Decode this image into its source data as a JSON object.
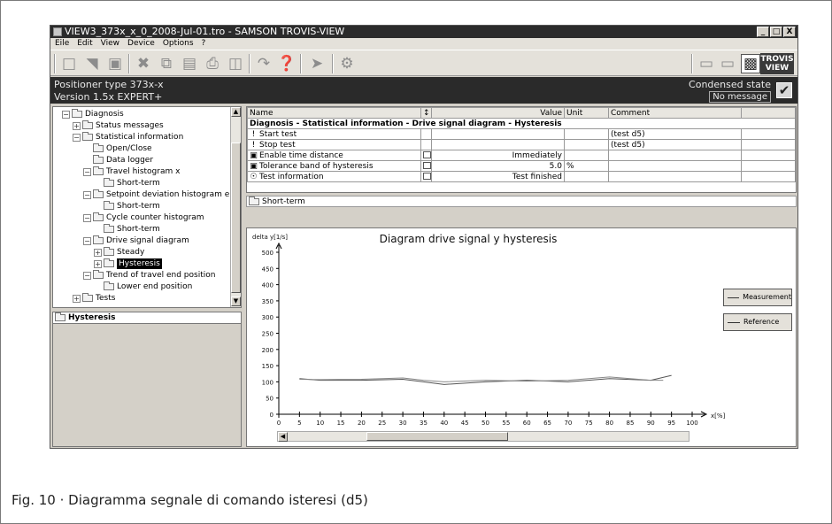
{
  "window": {
    "title": "VIEW3_373x_x_0_2008-Jul-01.tro - SAMSON TROVIS-VIEW",
    "buttons": [
      "_",
      "□",
      "X"
    ]
  },
  "menu": [
    "Eile",
    "Edit",
    "View",
    "Device",
    "Options",
    "?"
  ],
  "toolbar": {
    "buttons": [
      "new-icon",
      "open-icon",
      "save-icon",
      "cut-icon",
      "copy-icon",
      "paste-icon",
      "print-icon",
      "print-preview-icon",
      "transfer-icon",
      "help-icon",
      "tools-icon",
      "settings-icon"
    ],
    "logo_line1": "TROVIS",
    "logo_line2": "VIEW"
  },
  "info": {
    "line1": "Positioner type 373x-x",
    "line2": "Version 1.5x EXPERT+",
    "state_label": "Condensed state",
    "message": "No message"
  },
  "tree": {
    "items": [
      {
        "label": "Diagnosis",
        "expander": "−",
        "sel": false
      },
      {
        "label": "Status messages",
        "expander": "+",
        "sel": false
      },
      {
        "label": "Statistical information",
        "expander": "−",
        "sel": false
      },
      {
        "label": "Open/Close",
        "expander": "",
        "sel": false
      },
      {
        "label": "Data logger",
        "expander": "",
        "sel": false
      },
      {
        "label": "Travel histogram x",
        "expander": "−",
        "sel": false
      },
      {
        "label": "Short-term",
        "expander": "",
        "sel": false
      },
      {
        "label": "Setpoint deviation histogram e",
        "expander": "−",
        "sel": false
      },
      {
        "label": "Short-term",
        "expander": "",
        "sel": false
      },
      {
        "label": "Cycle counter histogram",
        "expander": "−",
        "sel": false
      },
      {
        "label": "Short-term",
        "expander": "",
        "sel": false
      },
      {
        "label": "Drive signal diagram",
        "expander": "−",
        "sel": false
      },
      {
        "label": "Steady",
        "expander": "+",
        "sel": false
      },
      {
        "label": "Hysteresis",
        "expander": "+",
        "sel": true
      },
      {
        "label": "Trend of travel end position",
        "expander": "−",
        "sel": false
      },
      {
        "label": "Lower end position",
        "expander": "",
        "sel": false
      },
      {
        "label": "Tests",
        "expander": "+",
        "sel": false
      }
    ]
  },
  "hysteresis_panel": {
    "title": "Hysteresis"
  },
  "grid": {
    "headers": [
      "Name",
      "↕",
      "Value",
      "Unit",
      "Comment",
      ""
    ],
    "section": "Diagnosis - Statistical information - Drive signal diagram - Hysteresis",
    "rows": [
      {
        "icon": "!",
        "name": "Start test",
        "value": "",
        "unit": "",
        "comment": "(test d5)"
      },
      {
        "icon": "!",
        "name": "Stop test",
        "value": "",
        "unit": "",
        "comment": "(test d5)"
      },
      {
        "icon": "▣",
        "name": "Enable time distance",
        "value": "Immediately",
        "unit": "",
        "comment": ""
      },
      {
        "icon": "▣",
        "name": "Tolerance band of hysteresis",
        "value": "5.0",
        "unit": "%",
        "comment": ""
      },
      {
        "icon": "☉",
        "name": "Test information",
        "value": "Test finished",
        "unit": "",
        "comment": ""
      }
    ],
    "subfolder": "Short-term"
  },
  "chart_data": {
    "type": "line",
    "title": "Diagram drive signal y hysteresis",
    "ylabel": "delta y[1/s]",
    "xlabel": "x[%]",
    "xlim": [
      0,
      100
    ],
    "ylim": [
      0,
      500
    ],
    "x_ticks": [
      0,
      5,
      10,
      15,
      20,
      25,
      30,
      35,
      40,
      45,
      50,
      55,
      60,
      65,
      70,
      75,
      80,
      85,
      90,
      95,
      100
    ],
    "y_ticks": [
      0,
      50,
      100,
      150,
      200,
      250,
      300,
      350,
      400,
      450,
      500
    ],
    "series": [
      {
        "name": "Measurement",
        "x": [
          5,
          10,
          20,
          30,
          35,
          40,
          50,
          60,
          70,
          80,
          90,
          95
        ],
        "values": [
          110,
          105,
          105,
          108,
          100,
          92,
          100,
          105,
          100,
          110,
          105,
          120
        ]
      },
      {
        "name": "Reference",
        "x": [
          5,
          10,
          20,
          30,
          35,
          40,
          50,
          60,
          70,
          80,
          90,
          93
        ],
        "values": [
          108,
          107,
          108,
          112,
          105,
          100,
          105,
          102,
          105,
          115,
          105,
          105
        ]
      }
    ]
  },
  "caption": "Fig. 10 · Diagramma segnale di comando isteresi (d5)"
}
